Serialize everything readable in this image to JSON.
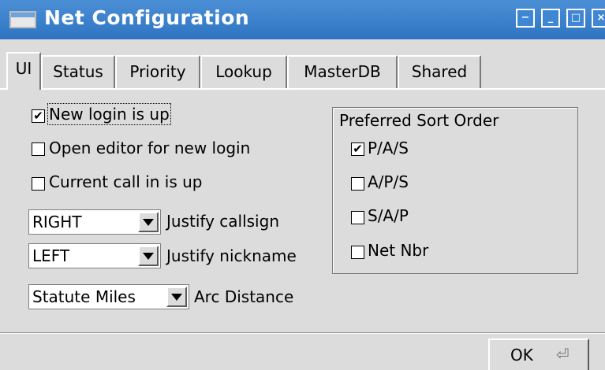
{
  "window": {
    "title": "Net Configuration",
    "buttons": [
      "−",
      "_",
      "□",
      "×"
    ]
  },
  "tabs": [
    "UI",
    "Status",
    "Priority",
    "Lookup",
    "MasterDB",
    "Shared"
  ],
  "options": {
    "new_login_up": {
      "label": "New login is up",
      "checked": true
    },
    "open_editor": {
      "label": "Open editor for new login",
      "checked": false
    },
    "current_call_up": {
      "label": "Current call in is up",
      "checked": false
    }
  },
  "justify": {
    "callsign": {
      "value": "RIGHT",
      "label": "Justify callsign"
    },
    "nickname": {
      "value": "LEFT",
      "label": "Justify nickname"
    }
  },
  "arc": {
    "value": "Statute Miles",
    "label": "Arc Distance"
  },
  "sort_order": {
    "title": "Preferred Sort Order",
    "items": [
      {
        "label": "P/A/S",
        "checked": true
      },
      {
        "label": "A/P/S",
        "checked": false
      },
      {
        "label": "S/A/P",
        "checked": false
      },
      {
        "label": "Net Nbr",
        "checked": false
      }
    ]
  },
  "ok_button": {
    "label": "OK",
    "icon": "enter-key-icon"
  },
  "check_glyph": "✔"
}
